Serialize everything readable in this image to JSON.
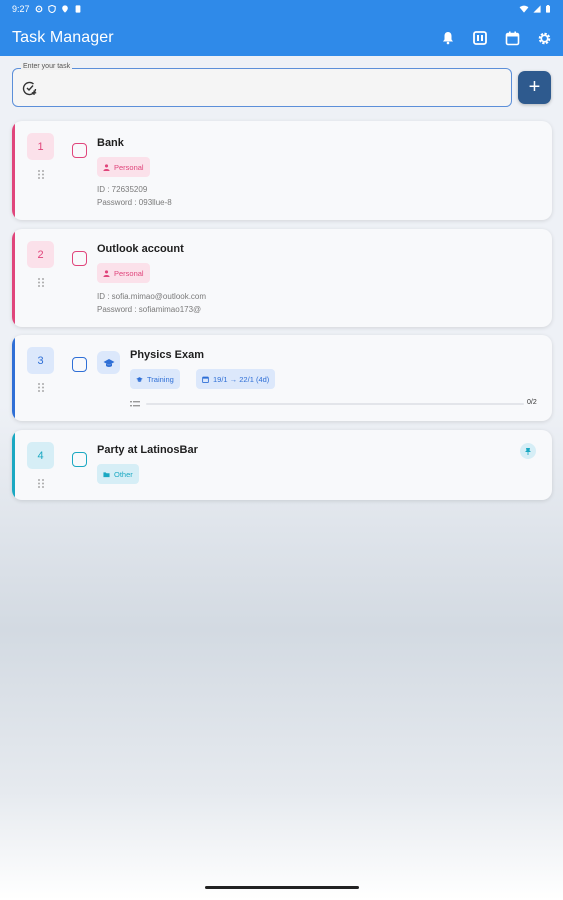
{
  "status": {
    "time": "9:27"
  },
  "app": {
    "title": "Task Manager"
  },
  "input": {
    "label": "Enter your task",
    "value": "",
    "add_label": "+"
  },
  "tasks": [
    {
      "index": "1",
      "title": "Bank",
      "category": "Personal",
      "notes": [
        "ID : 72635209",
        "Password : 093llue-8"
      ],
      "color": "#e0457b"
    },
    {
      "index": "2",
      "title": "Outlook account",
      "category": "Personal",
      "notes": [
        "ID : sofia.mimao@outlook.com",
        "Password : sofiamimao173@"
      ],
      "color": "#e0457b"
    },
    {
      "index": "3",
      "title": "Physics Exam",
      "category": "Training",
      "date_range": "19/1 → 22/1 (4d)",
      "progress_text": "0/2",
      "progress": 0,
      "color": "#2f6fd6"
    },
    {
      "index": "4",
      "title": "Party at LatinosBar",
      "category": "Other",
      "color": "#1aa8c2",
      "pinned": true
    }
  ],
  "colors": {
    "appbar": "#2f8ae9",
    "add_button": "#2e5a8e",
    "personal": "#e0457b",
    "training": "#2f6fd6",
    "other": "#1aa8c2"
  },
  "icons": [
    "bell-icon",
    "grid-view-icon",
    "calendar-icon",
    "settings-icon",
    "add-task-icon",
    "graduation-cap-icon",
    "drag-handle-icon",
    "pin-icon"
  ]
}
